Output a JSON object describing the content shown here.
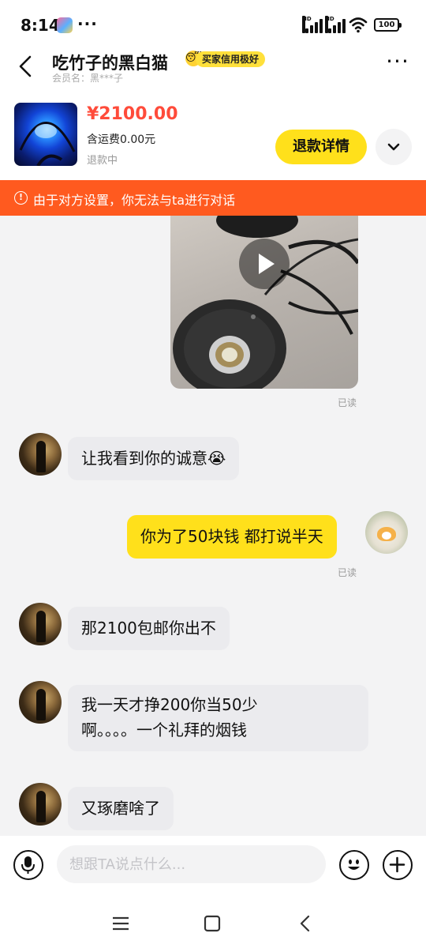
{
  "status_bar": {
    "time": "8:14",
    "dots": "···",
    "hd1": "HD",
    "hd2": "HD",
    "battery": "100"
  },
  "header": {
    "title": "吃竹子的黑白猫",
    "title_emoji": "😴",
    "badge": "买家信用极好",
    "member": "会员名：黑***子",
    "more": "···"
  },
  "order": {
    "price": "¥2100.00",
    "shipping": "含运费0.00元",
    "status": "退款中",
    "refund_button": "退款详情"
  },
  "warning": {
    "icon": "!",
    "text": "由于对方设置，你无法与ta进行对话"
  },
  "chat": {
    "video_read": "已读",
    "messages": [
      {
        "from": "them",
        "text": "让我看到你的诚意😭"
      },
      {
        "from": "me",
        "text": "你为了50块钱  都打说半天",
        "read": "已读"
      },
      {
        "from": "them",
        "text": "那2100包邮你出不"
      },
      {
        "from": "them",
        "text_line1": "我一天才挣200你当50少",
        "text_line2": "啊。。。。一个礼拜的烟钱"
      },
      {
        "from": "them",
        "text": "又琢磨啥了"
      }
    ]
  },
  "input": {
    "placeholder": "想跟TA说点什么..."
  },
  "colors": {
    "accent_yellow": "#ffe01b",
    "price_red": "#ff4b3a",
    "warning_orange": "#ff5a1f"
  },
  "icons": {
    "back": "chevron-left-icon",
    "more": "more-dots-icon",
    "expand": "chevron-down-icon",
    "voice": "microphone-icon",
    "emoji": "emoji-icon",
    "add": "plus-icon",
    "play": "play-icon",
    "warning": "info-icon"
  }
}
